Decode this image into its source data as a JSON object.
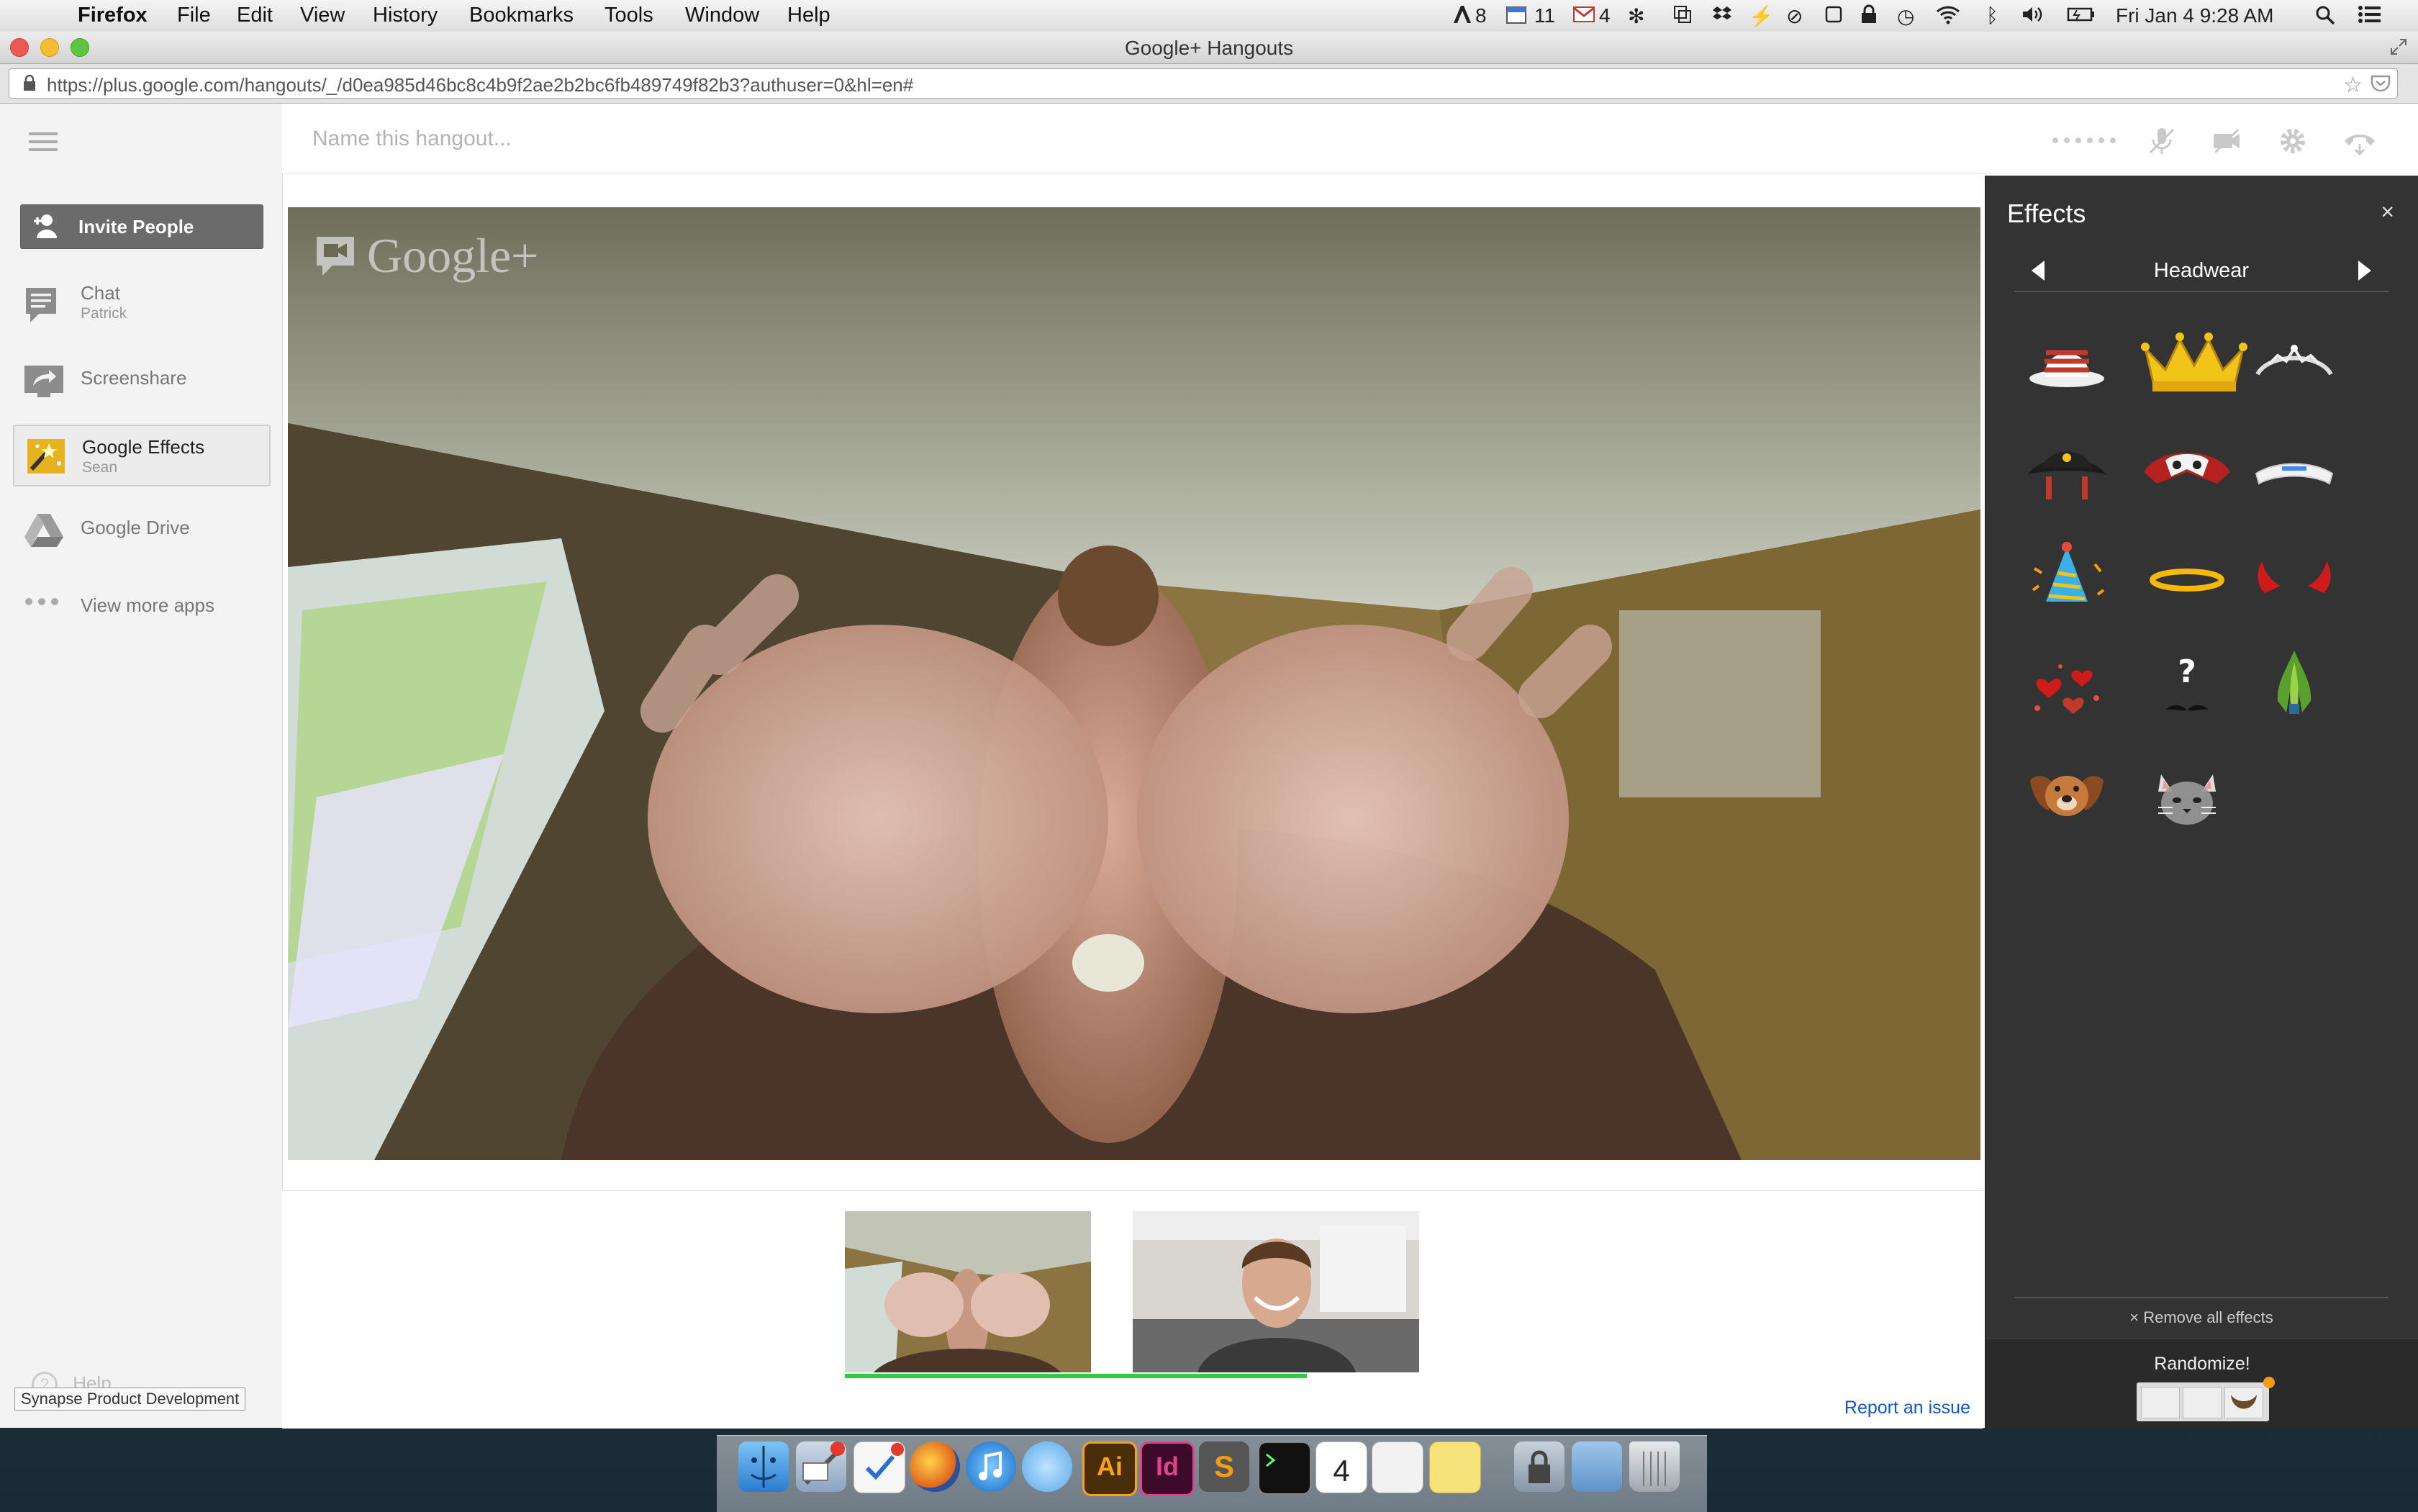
{
  "menubar": {
    "app_name": "Firefox",
    "menus": [
      "File",
      "Edit",
      "View",
      "History",
      "Bookmarks",
      "Tools",
      "Window",
      "Help"
    ],
    "adobe_count": "8",
    "calendar_count": "11",
    "gmail_count": "4",
    "clock": "Fri Jan 4  9:28 AM"
  },
  "window": {
    "title": "Google+ Hangouts",
    "url": "https://plus.google.com/hangouts/_/d0ea985d46bc8c4b9f2ae2b2bc6fb489749f82b3?authuser=0&hl=en#"
  },
  "hangout": {
    "name_placeholder": "Name this hangout...",
    "watermark": "Google+"
  },
  "sidebar": {
    "invite_label": "Invite People",
    "items": [
      {
        "label": "Chat",
        "sub": "Patrick"
      },
      {
        "label": "Screenshare",
        "sub": ""
      },
      {
        "label": "Google Effects",
        "sub": "Sean"
      },
      {
        "label": "Google Drive",
        "sub": ""
      },
      {
        "label": "View more apps",
        "sub": ""
      }
    ],
    "help_label": "Help",
    "tooltip": "Synapse Product Development"
  },
  "effects": {
    "title": "Effects",
    "close": "×",
    "category": "Headwear",
    "items": [
      "stovepipe-hat",
      "gold-crown",
      "tiara",
      "pirate-hat",
      "mask",
      "headband",
      "party-hat",
      "halo",
      "devil-horns",
      "hearts",
      "question-mustache",
      "feather-crest",
      "dog-face",
      "cat-face"
    ],
    "remove_label": "× Remove all effects",
    "randomize_label": "Randomize!"
  },
  "footer": {
    "report_label": "Report an issue"
  },
  "dock": {
    "items": [
      "finder",
      "mail",
      "reminders",
      "firefox",
      "itunes",
      "messages",
      "illustrator",
      "indesign",
      "sublime",
      "terminal",
      "calendar",
      "preview",
      "stickies",
      "keychain",
      "folder",
      "trash"
    ],
    "ai_label": "Ai",
    "id_label": "Id",
    "s_label": "S",
    "cal_day": "4"
  },
  "colors": {
    "effects_bg": "#333333",
    "invite_bg": "#6b6b6b",
    "link": "#1155cc",
    "active_speaker_bar": "#2ecc40"
  }
}
